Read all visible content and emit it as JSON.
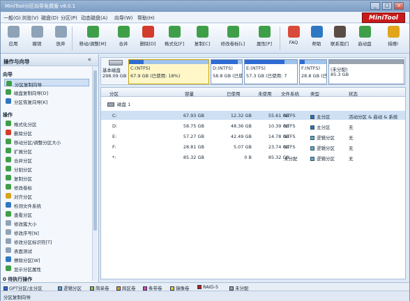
{
  "window": {
    "title": "MiniTool分区向导免费版 v8.0.1"
  },
  "menu": [
    "一般(G)",
    "浏览(V)",
    "磁盘(D)",
    "分区(P)",
    "动态磁盘(A)",
    "向导(W)",
    "帮助(H)"
  ],
  "brand": "MiniTool",
  "toolbar": [
    {
      "label": "应用",
      "icon": "check-icon",
      "color": "#8ea3b8"
    },
    {
      "label": "撤销",
      "icon": "undo-icon",
      "color": "#8ea3b8"
    },
    {
      "label": "放弃",
      "icon": "discard-icon",
      "color": "#8ea3b8"
    },
    {
      "label": "移动/调整[M]",
      "icon": "move-resize-icon",
      "color": "#3f9f49"
    },
    {
      "label": "合并",
      "icon": "merge-icon",
      "color": "#3f9f49"
    },
    {
      "label": "删除[D]",
      "icon": "delete-icon",
      "color": "#d33b2c"
    },
    {
      "label": "格式化[F]",
      "icon": "format-icon",
      "color": "#3f9f49"
    },
    {
      "label": "复制[C]",
      "icon": "copy-icon",
      "color": "#3f9f49"
    },
    {
      "label": "修改卷标[L]",
      "icon": "label-icon",
      "color": "#3f9f49"
    },
    {
      "label": "属性[P]",
      "icon": "properties-icon",
      "color": "#3f9f49"
    },
    {
      "label": "FAQ",
      "icon": "faq-icon",
      "color": "#d94a3a"
    },
    {
      "label": "帮助",
      "icon": "help-icon",
      "color": "#2e78c2"
    },
    {
      "label": "联系我们",
      "icon": "contact-icon",
      "color": "#5a4d45"
    },
    {
      "label": "启动盘",
      "icon": "boot-disk-icon",
      "color": "#3f9f49"
    },
    {
      "label": "捐赠!",
      "icon": "donate-icon",
      "color": "#e0a51a"
    }
  ],
  "sidebar": {
    "title": "操作与向导",
    "collapse": "«",
    "wizard_title": "向导",
    "wizard_items": [
      {
        "label": "分区复制向导",
        "color": "#3f9f49"
      },
      {
        "label": "磁盘复制向导[D]",
        "color": "#3f9f49"
      },
      {
        "label": "分区恢复向导[K]",
        "color": "#2e78c2"
      }
    ],
    "ops_title": "操作",
    "ops_items": [
      {
        "label": "格式化分区",
        "color": "#3f9f49"
      },
      {
        "label": "删除分区",
        "color": "#d33b2c"
      },
      {
        "label": "移动分区/调整分区大小",
        "color": "#3f9f49"
      },
      {
        "label": "扩展分区",
        "color": "#3f9f49"
      },
      {
        "label": "合并分区",
        "color": "#3f9f49"
      },
      {
        "label": "分割分区",
        "color": "#3f9f49"
      },
      {
        "label": "复制分区",
        "color": "#3f9f49"
      },
      {
        "label": "修改卷标",
        "color": "#3f9f49"
      },
      {
        "label": "对齐分区",
        "color": "#d9a21c"
      },
      {
        "label": "检测文件系统",
        "color": "#2e78c2"
      },
      {
        "label": "查看分区",
        "color": "#3f9f49"
      },
      {
        "label": "修改簇大小",
        "color": "#8ea3b8"
      },
      {
        "label": "修改序号[N]",
        "color": "#8ea3b8"
      },
      {
        "label": "修改分区标识符[T]",
        "color": "#8ea3b8"
      },
      {
        "label": "表面测试",
        "color": "#8ea3b8"
      },
      {
        "label": "擦除分区[W]",
        "color": "#2e78c2"
      },
      {
        "label": "显示分区属性",
        "color": "#3f9f49"
      }
    ],
    "pending_title": "0 待执行操作"
  },
  "diskmap": {
    "disk_name": "基本磁盘",
    "disk_size": "298.09 GB",
    "segments": [
      {
        "line1": "C:(NTFS)",
        "line2": "67.9 GB (已使用: 18%)",
        "used_fraction": 0.18,
        "color": "#2f6bd4",
        "selected": true
      },
      {
        "line1": "D:(NTFS)",
        "line2": "58.8 GB (已使用: 82",
        "used_fraction": 0.82,
        "color": "#2f6bd4",
        "selected": false
      },
      {
        "line1": "E:(NTFS)",
        "line2": "57.3 GB (已使用: 7",
        "used_fraction": 0.74,
        "color": "#2f6bd4",
        "selected": false
      },
      {
        "line1": "F:(NTFS)",
        "line2": "28.8 GB (已",
        "used_fraction": 0.18,
        "color": "#2f6bd4",
        "selected": false
      },
      {
        "line1": "(未分配)",
        "line2": "85.3 GB",
        "used_fraction": 0,
        "color": "#9aa4ae",
        "selected": false
      }
    ]
  },
  "table": {
    "headers": [
      "分区",
      "容量",
      "已使用",
      "未使用",
      "文件系统",
      "类型",
      "状态"
    ],
    "disk_label": "磁盘 1",
    "rows": [
      {
        "part": "C:",
        "cap": "67.93 GB",
        "used": "12.32 GB",
        "free": "55.61 GB",
        "fs": "NTFS",
        "type": "主分区",
        "type_color": "#2f6bd4",
        "status": "活动分区 & 启动 & 系统"
      },
      {
        "part": "D:",
        "cap": "58.75 GB",
        "used": "48.36 GB",
        "free": "10.39 GB",
        "fs": "NTFS",
        "type": "主分区",
        "type_color": "#2f6bd4",
        "status": "无"
      },
      {
        "part": "E:",
        "cap": "57.27 GB",
        "used": "42.49 GB",
        "free": "14.78 GB",
        "fs": "NTFS",
        "type": "逻辑分区",
        "type_color": "#5ea8d8",
        "status": "无"
      },
      {
        "part": "F:",
        "cap": "28.81 GB",
        "used": "5.07 GB",
        "free": "23.74 GB",
        "fs": "NTFS",
        "type": "逻辑分区",
        "type_color": "#5ea8d8",
        "status": "无"
      },
      {
        "part": "*:",
        "cap": "85.32 GB",
        "used": "0 B",
        "free": "85.32 GB",
        "fs": "未分配",
        "type": "逻辑分区",
        "type_color": "#5ea8d8",
        "status": "无"
      }
    ]
  },
  "legend": [
    {
      "label": "GPT分区/主分区",
      "color": "#2f6bd4"
    },
    {
      "label": "逻辑分区",
      "color": "#5ea8d8"
    },
    {
      "label": "简单卷",
      "color": "#8ac34a"
    },
    {
      "label": "跨区卷",
      "color": "#d9a21c"
    },
    {
      "label": "条带卷",
      "color": "#c94fb0"
    },
    {
      "label": "镜像卷",
      "color": "#d8d23a"
    },
    {
      "label": "RAID-5",
      "color": "#b0231c"
    },
    {
      "label": "未分配",
      "color": "#9aa4ae"
    }
  ],
  "status": "分区复制向导"
}
